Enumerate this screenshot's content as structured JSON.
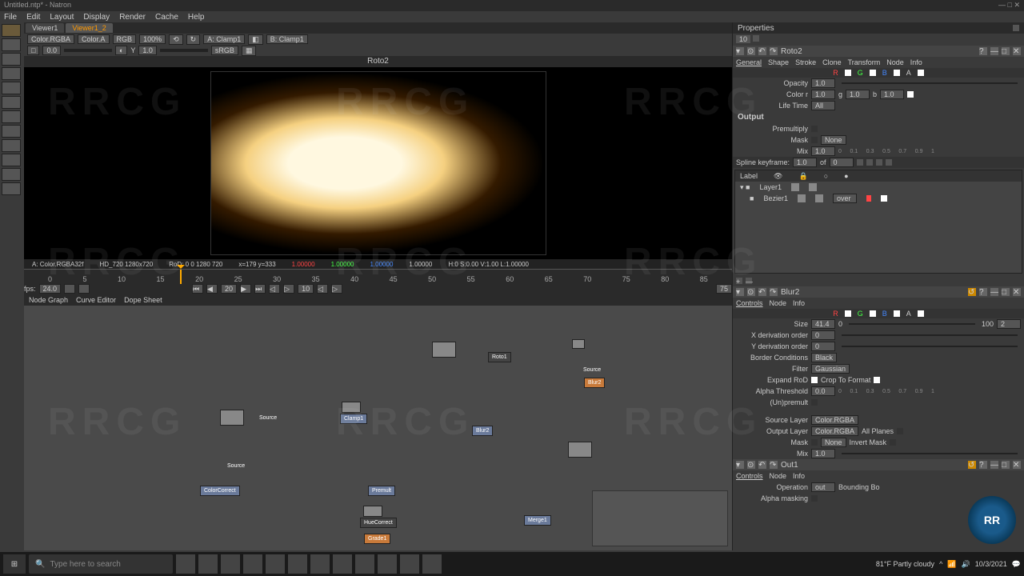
{
  "title": "Untitled.ntp* - Natron",
  "menu": [
    "File",
    "Edit",
    "Layout",
    "Display",
    "Render",
    "Cache",
    "Help"
  ],
  "viewer_tabs": [
    "Viewer1",
    "Viewer1_2"
  ],
  "viewer_toolbar": {
    "layer": "Color.RGBA",
    "alpha": "Color.A",
    "channels": "RGB",
    "zoom": "100%",
    "a_input": "A: Clamp1",
    "b_input": "B: Clamp1"
  },
  "viewer_toolbar2": {
    "x_val": "0.0",
    "y_label": "Y",
    "y_val": "1.0",
    "colorspace": "sRGB"
  },
  "viewer_header": "Roto2",
  "viewer_status": {
    "format": "A: Color.RGBA32f",
    "res": "HD_720 1280x720",
    "rod": "RoD: 0 0 1280 720",
    "coords": "x=179 y=333",
    "r": "1.00000",
    "g": "1.00000",
    "b": "1.00000",
    "a": "1.00000",
    "hsv": "H:0 S:0.00 V:1.00 L:1.00000"
  },
  "timeline": {
    "ticks": [
      "0",
      "5",
      "10",
      "15",
      "20",
      "25",
      "30",
      "35",
      "40",
      "45",
      "50",
      "55",
      "60",
      "65",
      "70",
      "75",
      "80",
      "85"
    ],
    "fps_label": "fps:",
    "fps": "24.0",
    "current": "20",
    "count": "10",
    "end": "75"
  },
  "node_tabs": [
    "Node Graph",
    "Curve Editor",
    "Dope Sheet"
  ],
  "nodes": {
    "source1": "Source",
    "source2": "Source",
    "clamp": "Clamp1",
    "roto": "Roto1",
    "blur": "Blur2",
    "merge": "Merge1",
    "grade": "Grade1"
  },
  "properties": {
    "title": "Properties",
    "count": "10"
  },
  "roto_panel": {
    "title": "Roto2",
    "tabs": [
      "General",
      "Shape",
      "Stroke",
      "Clone",
      "Transform",
      "Node",
      "Info"
    ],
    "channels": [
      {
        "l": "R",
        "c": "ch-r"
      },
      {
        "l": "G",
        "c": "ch-g"
      },
      {
        "l": "B",
        "c": "ch-b"
      },
      {
        "l": "A",
        "c": "ch-a"
      }
    ],
    "opacity_label": "Opacity",
    "opacity": "1.0",
    "color_label": "Color r",
    "color_r": "1.0",
    "color_g": "1.0",
    "color_b": "1.0",
    "lifetime_label": "Life Time",
    "lifetime": "All",
    "output_label": "Output",
    "premult_label": "Premultiply",
    "mask_label": "Mask",
    "mask": "None",
    "mix_label": "Mix",
    "mix": "1.0",
    "spline_label": "Spline keyframe:",
    "spline_val": "1.0",
    "spline_of": "of",
    "spline_total": "0",
    "layer_header": "Label",
    "layer1": "Layer1",
    "bezier1": "Bezier1",
    "blend": "over"
  },
  "blur_panel": {
    "title": "Blur2",
    "tabs": [
      "Controls",
      "Node",
      "Info"
    ],
    "size_label": "Size",
    "size": "41.4",
    "size_min": "0",
    "size_max": "100",
    "size_mark": "2",
    "xder_label": "X derivation order",
    "xder": "0",
    "yder_label": "Y derivation order",
    "yder": "0",
    "border_label": "Border Conditions",
    "border": "Black",
    "filter_label": "Filter",
    "filter": "Gaussian",
    "expand_label": "Expand RoD",
    "crop_label": "Crop To Format",
    "alpha_label": "Alpha Threshold",
    "alpha": "0.0",
    "unpremult_label": "(Un)premult",
    "source_label": "Source Layer",
    "source": "Color.RGBA",
    "output_label": "Output Layer",
    "output": "Color.RGBA",
    "allplanes_label": "All Planes",
    "mask_label": "Mask",
    "mask": "None",
    "invert_label": "Invert Mask",
    "mix_label": "Mix",
    "mix": "1.0"
  },
  "out_panel": {
    "title": "Out1",
    "tabs": [
      "Controls",
      "Node",
      "Info"
    ],
    "op_label": "Operation",
    "op": "out",
    "bbox_label": "Bounding Bo",
    "alpha_label": "Alpha masking"
  },
  "slider_ticks_01": [
    "0",
    "0.1",
    "0.3",
    "0.5",
    "0.7",
    "0.9",
    "1"
  ],
  "taskbar": {
    "search": "Type here to search",
    "weather": "81°F Partly cloudy",
    "date": "10/3/2021"
  }
}
